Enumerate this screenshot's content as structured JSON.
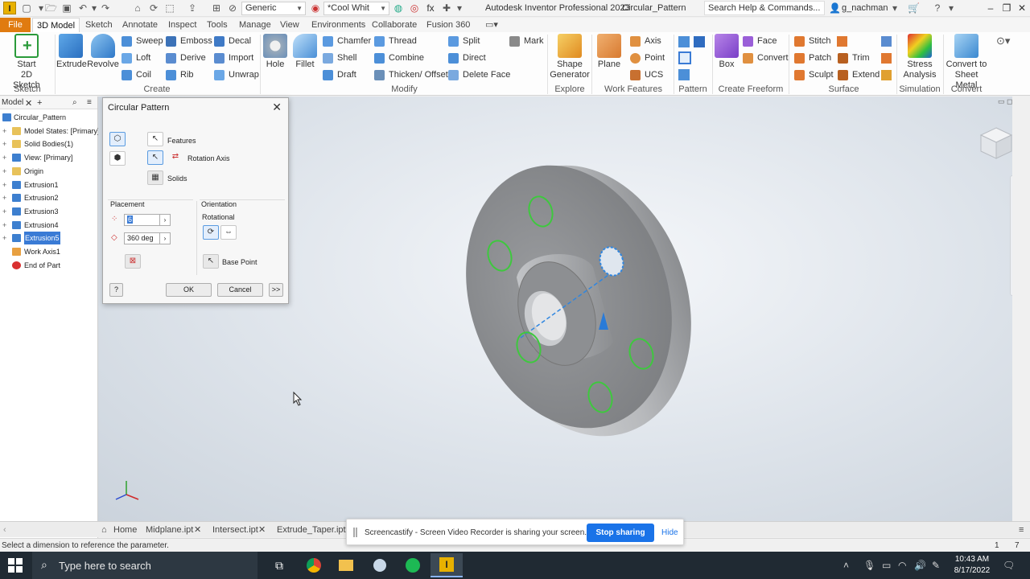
{
  "title_bar": {
    "app_logo": "I",
    "appearance_select": "Generic",
    "visual_style_select": "*Cool Whit",
    "app_title": "Autodesk Inventor Professional 2023",
    "doc_title": "Circular_Pattern",
    "help_search_placeholder": "Search Help & Commands...",
    "user_name": "g_nachman"
  },
  "ribbon_tabs": [
    "File",
    "3D Model",
    "Sketch",
    "Annotate",
    "Inspect",
    "Tools",
    "Manage",
    "View",
    "Environments",
    "Collaborate",
    "Fusion 360"
  ],
  "ribbon": {
    "sketch": {
      "start_sketch": "Start\n2D Sketch",
      "label": "Sketch"
    },
    "create": {
      "extrude": "Extrude",
      "revolve": "Revolve",
      "sweep": "Sweep",
      "loft": "Loft",
      "coil": "Coil",
      "emboss": "Emboss",
      "derive": "Derive",
      "rib": "Rib",
      "decal": "Decal",
      "import": "Import",
      "unwrap": "Unwrap",
      "label": "Create"
    },
    "modify": {
      "hole": "Hole",
      "fillet": "Fillet",
      "chamfer": "Chamfer",
      "shell": "Shell",
      "draft": "Draft",
      "thread": "Thread",
      "combine": "Combine",
      "thicken": "Thicken/ Offset",
      "split": "Split",
      "direct": "Direct",
      "delete_face": "Delete Face",
      "mark": "Mark",
      "label": "Modify"
    },
    "explore": {
      "shape_generator": "Shape\nGenerator",
      "label": "Explore"
    },
    "work_features": {
      "plane": "Plane",
      "axis": "Axis",
      "point": "Point",
      "ucs": "UCS",
      "label": "Work Features"
    },
    "pattern": {
      "label": "Pattern"
    },
    "create_freeform": {
      "box": "Box",
      "face": "Face",
      "convert": "Convert",
      "label": "Create Freeform"
    },
    "surface": {
      "stitch": "Stitch",
      "patch": "Patch",
      "sculpt": "Sculpt",
      "trim": "Trim",
      "extend": "Extend",
      "label": "Surface"
    },
    "simulation": {
      "stress_analysis": "Stress\nAnalysis",
      "label": "Simulation"
    },
    "convert": {
      "convert_sheet_metal": "Convert to\nSheet Metal",
      "label": "Convert"
    }
  },
  "browser": {
    "tab_label": "Model",
    "items": [
      {
        "label": "Circular_Pattern",
        "color": "#3d7fcf"
      },
      {
        "label": "Model States: [Primary]",
        "color": "#e8c25a"
      },
      {
        "label": "Solid Bodies(1)",
        "color": "#e8c25a"
      },
      {
        "label": "View: [Primary]",
        "color": "#3d7fcf"
      },
      {
        "label": "Origin",
        "color": "#e8c25a"
      },
      {
        "label": "Extrusion1",
        "color": "#3d7fcf"
      },
      {
        "label": "Extrusion2",
        "color": "#3d7fcf"
      },
      {
        "label": "Extrusion3",
        "color": "#3d7fcf"
      },
      {
        "label": "Extrusion4",
        "color": "#3d7fcf"
      },
      {
        "label": "Extrusion5",
        "color": "#3d7fcf"
      },
      {
        "label": "Work Axis1",
        "color": "#e8a040"
      },
      {
        "label": "End of Part",
        "color": "#d93030"
      }
    ]
  },
  "dialog": {
    "title": "Circular Pattern",
    "features": "Features",
    "rotation_axis": "Rotation Axis",
    "solids": "Solids",
    "placement": "Placement",
    "count_value": "6",
    "angle_value": "360 deg",
    "orientation": "Orientation",
    "rotational": "Rotational",
    "base_point": "Base Point",
    "ok": "OK",
    "cancel": "Cancel",
    "more": ">>",
    "help": "?"
  },
  "doc_tabs": [
    "Home",
    "Midplane.ipt",
    "Intersect.ipt",
    "Extrude_Taper.ipt"
  ],
  "status": {
    "text": "Select a dimension to reference the parameter.",
    "num1": "1",
    "num2": "7"
  },
  "share_bar": {
    "text": "Screencastify - Screen Video Recorder is sharing your screen.",
    "stop": "Stop sharing",
    "hide": "Hide"
  },
  "taskbar": {
    "search": "Type here to search",
    "time": "10:43 AM",
    "date": "8/17/2022"
  },
  "colors": {
    "file_tab": "#e07b10",
    "accent_blue": "#1a73e8",
    "selected": "#3a7bd5",
    "part_gray": "#8d8f92",
    "hole_green": "#3ec83e"
  }
}
